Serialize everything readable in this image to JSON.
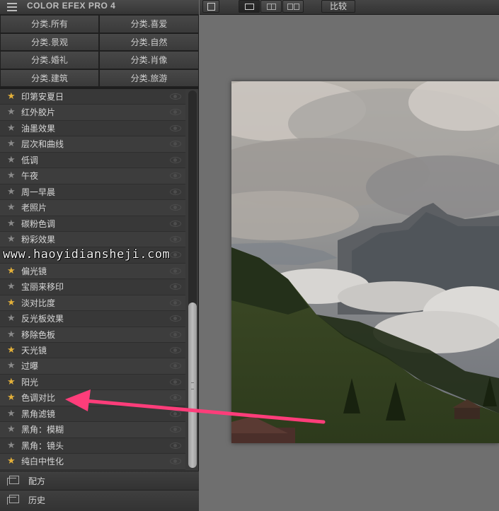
{
  "app": {
    "title": "COLOR EFEX PRO 4"
  },
  "categories": [
    "分类.所有",
    "分类.喜爱",
    "分类.景观",
    "分类.自然",
    "分类.婚礼",
    "分类.肖像",
    "分类.建筑",
    "分类.旅游"
  ],
  "filters": [
    {
      "label": "印第安夏日",
      "favorite": true
    },
    {
      "label": "红外胶片",
      "favorite": false
    },
    {
      "label": "油墨效果",
      "favorite": false
    },
    {
      "label": "层次和曲线",
      "favorite": false
    },
    {
      "label": "低调",
      "favorite": false
    },
    {
      "label": "午夜",
      "favorite": false
    },
    {
      "label": "周一早晨",
      "favorite": false
    },
    {
      "label": "老照片",
      "favorite": false
    },
    {
      "label": "碳粉色调",
      "favorite": false
    },
    {
      "label": "粉彩效果",
      "favorite": false
    },
    {
      "label": "",
      "favorite": false
    },
    {
      "label": "偏光镜",
      "favorite": true
    },
    {
      "label": "宝丽来移印",
      "favorite": false
    },
    {
      "label": "淡对比度",
      "favorite": true
    },
    {
      "label": "反光板效果",
      "favorite": false
    },
    {
      "label": "移除色板",
      "favorite": false
    },
    {
      "label": "天光镜",
      "favorite": true
    },
    {
      "label": "过曝",
      "favorite": false
    },
    {
      "label": "阳光",
      "favorite": true
    },
    {
      "label": "色调对比",
      "favorite": true
    },
    {
      "label": "黑角滤镜",
      "favorite": false
    },
    {
      "label": "黑角：模糊",
      "favorite": false
    },
    {
      "label": "黑角：镜头",
      "favorite": false
    },
    {
      "label": "纯白中性化",
      "favorite": true
    }
  ],
  "bottom_panels": {
    "recipes": "配方",
    "history": "历史"
  },
  "toolbar": {
    "compare_label": "比较"
  },
  "watermark": "www.haoyidiansheji.com",
  "colors": {
    "favorite_star": "#e3b03a",
    "arrow": "#ff3d7a"
  },
  "icons": [
    "menu-icon",
    "export-icon",
    "single-view-icon",
    "split-view-icon",
    "side-by-side-icon",
    "star-icon",
    "eye-icon",
    "recipes-icon",
    "history-icon"
  ]
}
